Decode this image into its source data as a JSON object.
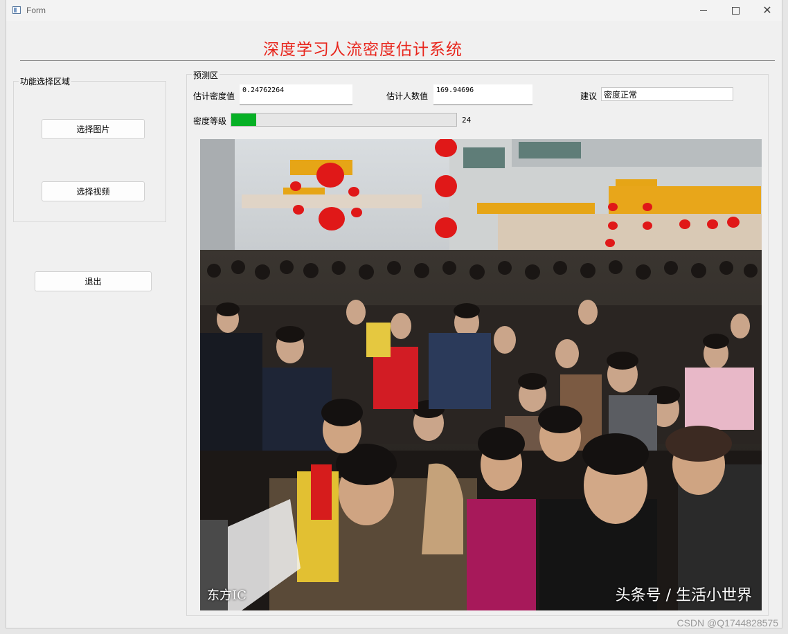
{
  "window": {
    "title": "Form"
  },
  "header": {
    "title": "深度学习人流密度估计系统"
  },
  "function_group": {
    "label": "功能选择区域",
    "select_image": "选择图片",
    "select_video": "选择视频"
  },
  "exit_label": "退出",
  "prediction": {
    "label": "预测区",
    "density_label": "估计密度值",
    "density_value": "0.24762264",
    "count_label": "估计人数值",
    "count_value": "169.94696",
    "advice_label": "建议",
    "advice_value": "密度正常",
    "level_label": "密度等级",
    "level_value": "24",
    "level_percent": 24
  },
  "image": {
    "watermark": "头条号 / 生活小世界",
    "logo": "东方IC"
  },
  "footer": {
    "credit": "CSDN @Q1744828575"
  },
  "colors": {
    "title": "#e8251c",
    "progress": "#06b025"
  }
}
